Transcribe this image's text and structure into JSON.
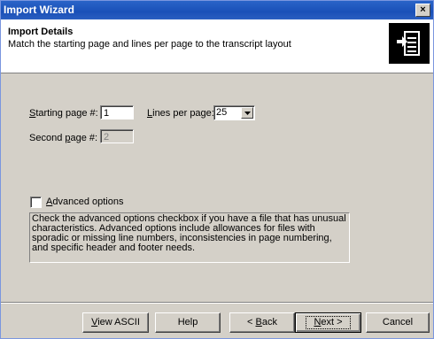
{
  "window": {
    "title": "Import Wizard",
    "close_glyph": "×"
  },
  "header": {
    "title": "Import Details",
    "subtitle": "Match the starting page and lines per page to the transcript layout",
    "icon": "import-document-icon"
  },
  "form": {
    "starting_page": {
      "label_u": "S",
      "label_rest": "tarting page #:",
      "value": "1"
    },
    "lines_per_page": {
      "label_u": "L",
      "label_rest": "ines per page:",
      "value": "25"
    },
    "second_page": {
      "label_pre": "Second ",
      "label_u": "p",
      "label_rest": "age #:",
      "value": "2"
    }
  },
  "advanced": {
    "checked": false,
    "label_u": "A",
    "label_rest": "dvanced options",
    "description": "Check the advanced options checkbox if you have a file that has unusual characteristics. Advanced options include allowances for files with sporadic or missing line numbers, inconsistencies in page numbering, and specific header and footer needs."
  },
  "buttons": {
    "view_ascii_u": "V",
    "view_ascii_rest": "iew ASCII",
    "help": "Help",
    "back_pre": "< ",
    "back_u": "B",
    "back_rest": "ack",
    "next_u": "N",
    "next_rest": "ext >",
    "cancel": "Cancel"
  }
}
